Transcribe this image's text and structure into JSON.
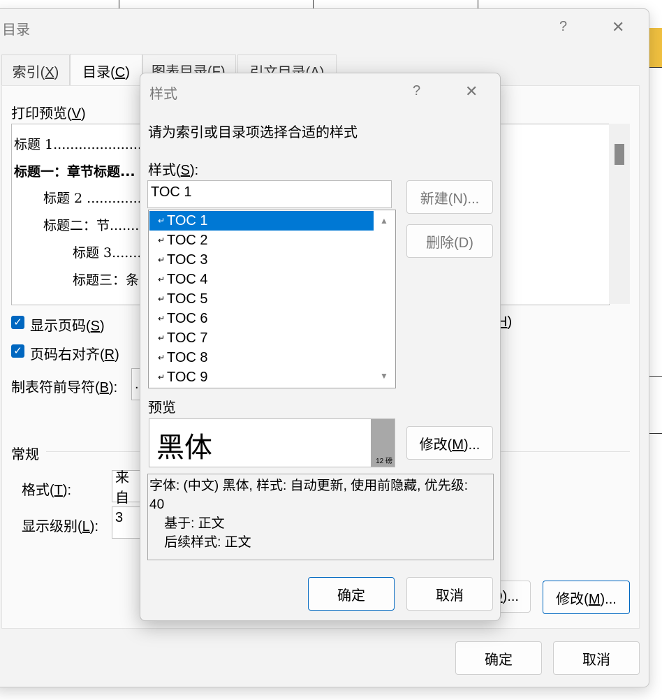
{
  "outer_dialog": {
    "title": "目录",
    "help": "?",
    "close": "✕",
    "tabs": [
      {
        "label": "索引(",
        "key": "X",
        "suffix": ")"
      },
      {
        "label": "目录(",
        "key": "C",
        "suffix": ")"
      },
      {
        "label": "图表目录(",
        "key": "F",
        "suffix": ")"
      },
      {
        "label": "引文目录(",
        "key": "A",
        "suffix": ")"
      }
    ],
    "print_preview_label": "打印预览(",
    "print_preview_key": "V",
    "print_preview_suffix": ")",
    "preview_lines": [
      "标题  1.........................",
      "标题一：章节标题...",
      "标题  2 ...................",
      "标题二：节.........",
      "标题  3...........",
      "标题三：条"
    ],
    "show_page_numbers": {
      "label": "显示页码(",
      "key": "S",
      "suffix": ")"
    },
    "right_align": {
      "label": "页码右对齐(",
      "key": "R",
      "suffix": ")"
    },
    "tab_leader": {
      "label": "制表符前导符(",
      "key": "B",
      "suffix": "):",
      "value": "."
    },
    "hyperlink_fragment": {
      "key": "H",
      "suffix": ")"
    },
    "general_label": "常规",
    "format": {
      "label": "格式(",
      "key": "T",
      "suffix": "):",
      "value": "来自"
    },
    "show_levels": {
      "label": "显示级别(",
      "key": "L",
      "suffix": "):",
      "value": "3"
    },
    "options_fragment": {
      "key": "O",
      "suffix": ")..."
    },
    "modify_button": {
      "label": "修改(",
      "key": "M",
      "suffix": ")..."
    },
    "ok": "确定",
    "cancel": "取消"
  },
  "style_dialog": {
    "title": "样式",
    "help": "?",
    "close": "✕",
    "instruction": "请为索引或目录项选择合适的样式",
    "styles_label": {
      "label": "样式(",
      "key": "S",
      "suffix": "):"
    },
    "style_input_value": "TOC 1",
    "style_list": [
      "TOC 1",
      "TOC 2",
      "TOC 3",
      "TOC 4",
      "TOC 5",
      "TOC 6",
      "TOC 7",
      "TOC 8",
      "TOC 9"
    ],
    "selected_index": 0,
    "new_button": "新建(N)...",
    "delete_button": "删除(D)",
    "preview_label": "预览",
    "preview_sample": "黑体",
    "preview_size": "12 磅",
    "modify_button": {
      "label": "修改(",
      "key": "M",
      "suffix": ")..."
    },
    "description_lines": [
      "字体: (中文) 黑体, 样式: 自动更新, 使用前隐藏, 优先级:",
      "40",
      "    基于: 正文",
      "    后续样式: 正文"
    ],
    "ok": "确定",
    "cancel": "取消"
  },
  "colors": {
    "accent": "#0078d4",
    "checkbox": "#0067c0",
    "primary_border": "#0067c0"
  }
}
